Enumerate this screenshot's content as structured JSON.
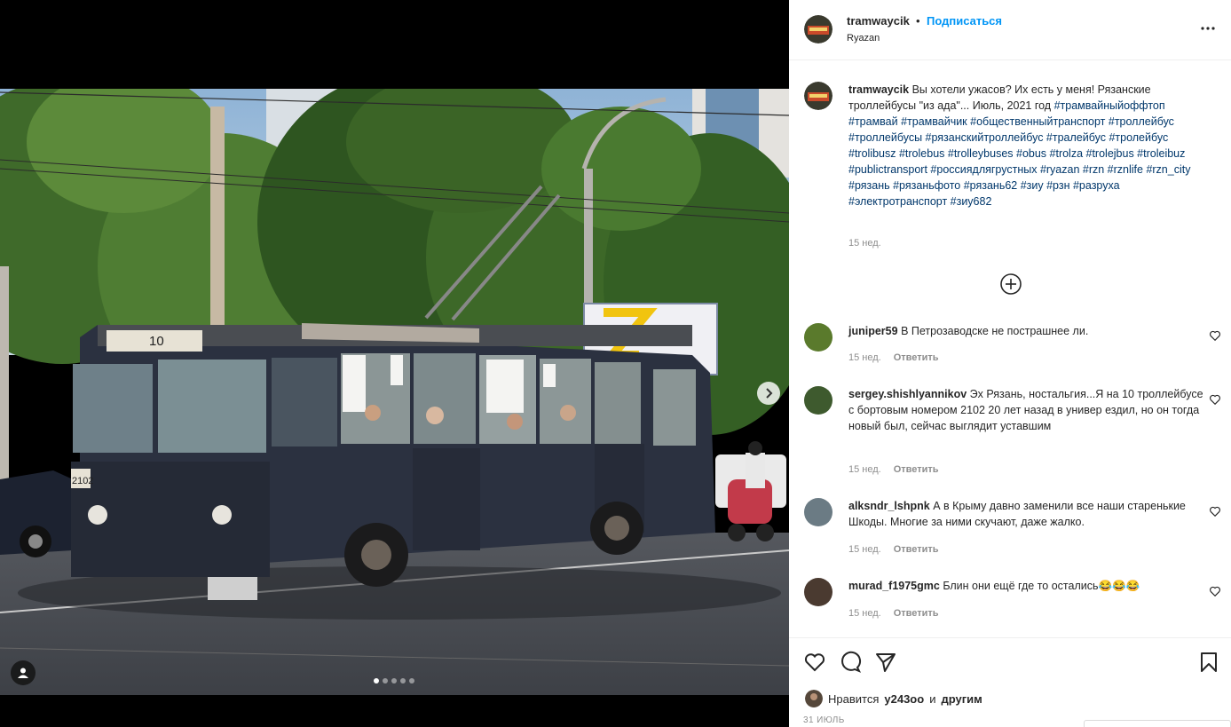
{
  "post": {
    "username": "tramwaycik",
    "separator": "•",
    "follow_label": "Подписаться",
    "location": "Ryazan",
    "more_icon": "more-horizontal-icon"
  },
  "caption": {
    "username": "tramwaycik",
    "text": "Вы хотели ужасов? Их есть у меня! Рязанские троллейбусы \"из ада\"... Июль, 2021 год",
    "hashtags": "#трамвайныйоффтоп #трамвай #трамвайчик #общественныйтранспорт #троллейбус #троллейбусы #рязанскийтроллейбус #тралейбус #тролейбус #trolibusz #trolebus #trolleybuses #obus #trolza #trolejbus #troleibuz #publictransport #россиядлягрустных #ryazan #rzn #rznlife #rzn_city #рязань #рязаньфото #рязань62 #зиу #рзн #разруха #электротранспорт #зиу682",
    "time": "15 нед."
  },
  "photo": {
    "route_number": "10",
    "fleet_number": "2102",
    "slides_total": 5,
    "slide_active": 1
  },
  "comments": [
    {
      "username": "juniper59",
      "text": "В Петрозаводске не пострашнее ли.",
      "time": "15 нед.",
      "reply": "Ответить",
      "avatar_color": "#5a7a2c"
    },
    {
      "username": "sergey.shishlyannikov",
      "text": "Эх Рязань, ностальгия...Я на 10 троллейбусе с бортовым номером 2102 20 лет назад в универ ездил, но он тогда новый был, сейчас выглядит уставшим",
      "time": "15 нед.",
      "reply": "Ответить",
      "avatar_color": "#3e5a2e"
    },
    {
      "username": "alksndr_lshpnk",
      "text": "А в Крыму давно заменили все наши старенькие Шкоды. Многие за ними скучают, даже жалко.",
      "time": "15 нед.",
      "reply": "Ответить",
      "avatar_color": "#6b7b84"
    },
    {
      "username": "murad_f1975gmc",
      "text": "Блин они ещё где то остались😂😂😂",
      "time": "15 нед.",
      "reply": "Ответить",
      "avatar_color": "#4a3a30"
    }
  ],
  "likes": {
    "prefix": "Нравится",
    "user": "y243oo",
    "and": "и",
    "others": "другим"
  },
  "date": "31 ИЮЛЬ",
  "icons": {
    "like": "heart-icon",
    "comment": "comment-icon",
    "share": "paper-plane-icon",
    "save": "bookmark-icon",
    "load_more": "plus-circle-icon",
    "next": "chevron-right-icon",
    "tag": "user-tag-icon"
  },
  "colors": {
    "link": "#0095f6",
    "hashtag": "#00376b",
    "muted": "#8e8e8e",
    "text": "#262626"
  }
}
